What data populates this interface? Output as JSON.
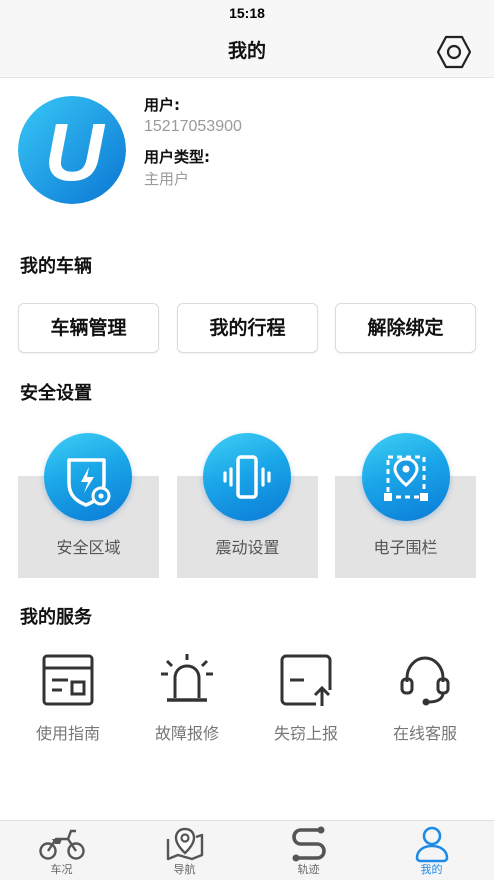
{
  "status_bar": {
    "time": "15:18"
  },
  "header": {
    "title": "我的"
  },
  "profile": {
    "user_label": "用户:",
    "phone": "15217053900",
    "type_label": "用户类型:",
    "type_value": "主用户",
    "logo_letter": "U"
  },
  "vehicles": {
    "title": "我的车辆",
    "buttons": [
      "车辆管理",
      "我的行程",
      "解除绑定"
    ]
  },
  "security": {
    "title": "安全设置",
    "items": [
      "安全区域",
      "震动设置",
      "电子围栏"
    ]
  },
  "services": {
    "title": "我的服务",
    "items": [
      "使用指南",
      "故障报修",
      "失窃上报",
      "在线客服"
    ]
  },
  "tabs": [
    {
      "label": "车况",
      "icon": "motorcycle-icon"
    },
    {
      "label": "导航",
      "icon": "map-pin-icon"
    },
    {
      "label": "轨迹",
      "icon": "route-icon"
    },
    {
      "label": "我的",
      "icon": "user-icon"
    }
  ],
  "colors": {
    "accent": "#1e8ce6",
    "gradient_start": "#3fd0f5",
    "gradient_end": "#0a7ad6"
  }
}
